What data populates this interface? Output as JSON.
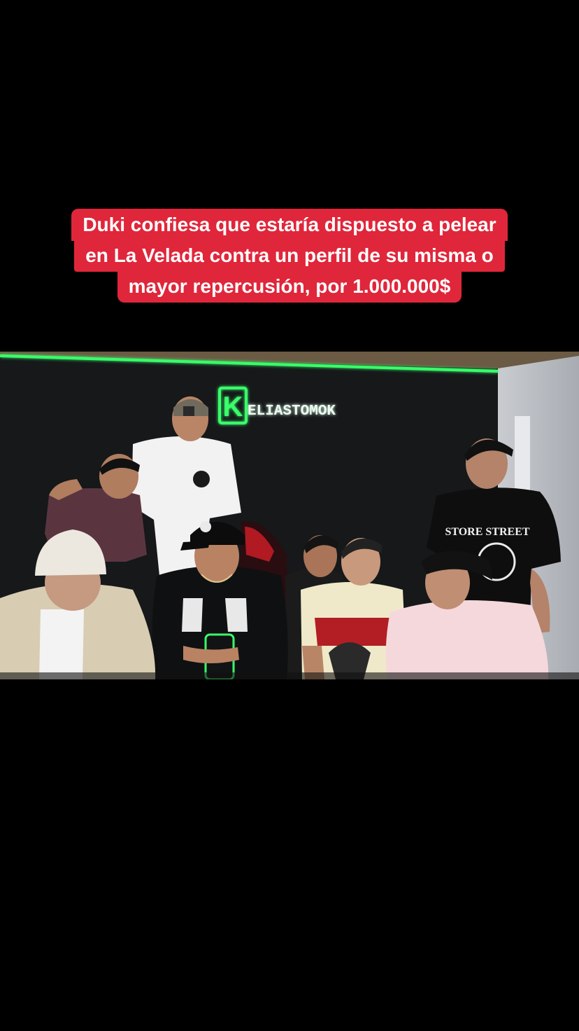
{
  "caption": {
    "lines": [
      "Duki confiesa que estaría dispuesto a pelear",
      "en La Velada contra un perfil de su misma o",
      "mayor repercusión, por 1.000.000$"
    ]
  },
  "video": {
    "neon_sign": "ELIASTOMOK",
    "neon_logo_letter": "K",
    "shirt_text": "STORE STREET",
    "colors": {
      "caption_bg": "#e0263a",
      "neon_green": "#39ff6a",
      "wall": "#16181a"
    }
  }
}
